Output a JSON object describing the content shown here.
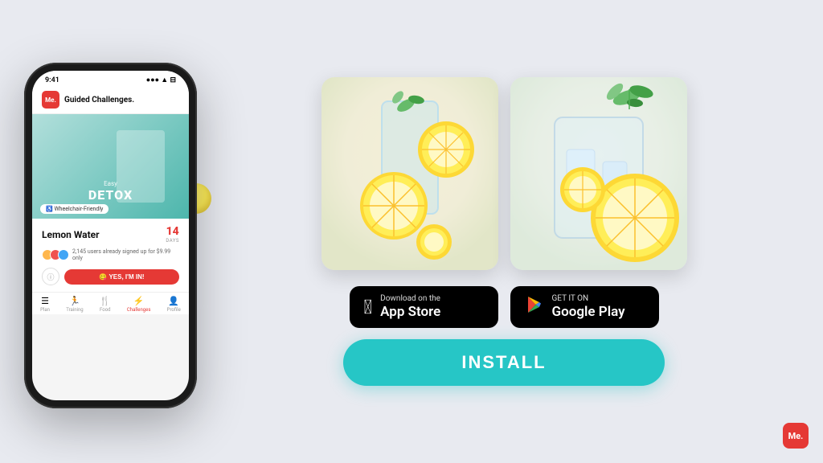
{
  "app": {
    "logo_text": "Me.",
    "app_name": "Guided Challenges.",
    "status_time": "9:41",
    "status_signal": "●●● ▲ ⊟",
    "challenge_easy": "Easy",
    "challenge_name": "DETOX",
    "wheelchair_label": "♿ Wheelchair-Friendly",
    "title": "Lemon Water",
    "days_number": "14",
    "days_label": "DAYS",
    "users_text": "2,145 users already signed up for $9.99 only",
    "yes_btn": "😋 YES, I'M IN!",
    "info_symbol": "ⓘ",
    "nav_items": [
      {
        "label": "Plan",
        "icon": "☰",
        "active": false
      },
      {
        "label": "Training",
        "icon": "🏃",
        "active": false
      },
      {
        "label": "Food",
        "icon": "🍴",
        "active": false
      },
      {
        "label": "Challenges",
        "icon": "⚡",
        "active": true
      },
      {
        "label": "Profile",
        "icon": "👤",
        "active": false
      }
    ]
  },
  "store": {
    "apple_top": "Download on the",
    "apple_main": "App Store",
    "google_top": "GET IT ON",
    "google_main": "Google Play"
  },
  "install": {
    "label": "INSTALL"
  },
  "corner_logo": "Me."
}
